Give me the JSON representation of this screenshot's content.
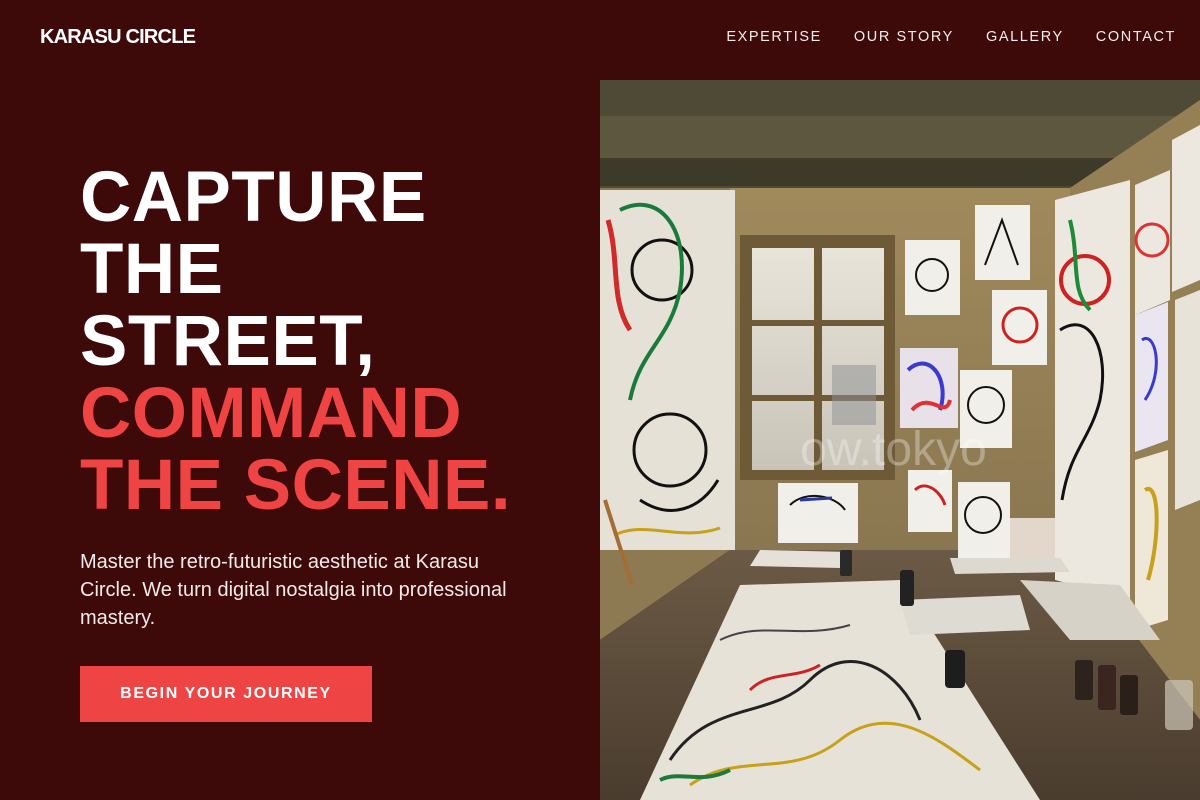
{
  "header": {
    "brand": "KARASU CIRCLE",
    "nav": [
      {
        "label": "EXPERTISE"
      },
      {
        "label": "OUR STORY"
      },
      {
        "label": "GALLERY"
      },
      {
        "label": "CONTACT"
      }
    ]
  },
  "hero": {
    "headline_lines": [
      {
        "text": "CAPTURE"
      },
      {
        "text": "THE"
      },
      {
        "text": "STREET,"
      },
      {
        "text": "COMMAND"
      },
      {
        "text": "THE SCENE."
      }
    ],
    "subtitle": "Master the retro-futuristic aesthetic at Karasu Circle. We turn digital nostalgia into professional mastery.",
    "cta_label": "BEGIN YOUR JOURNEY",
    "image": {
      "alt": "Art studio room with expressive drawings pinned on walls and large painted paper on the floor",
      "watermark": "ow.tokyo"
    }
  },
  "colors": {
    "background": "#3d0909",
    "accent": "#ef4444",
    "text": "#ffffff"
  }
}
